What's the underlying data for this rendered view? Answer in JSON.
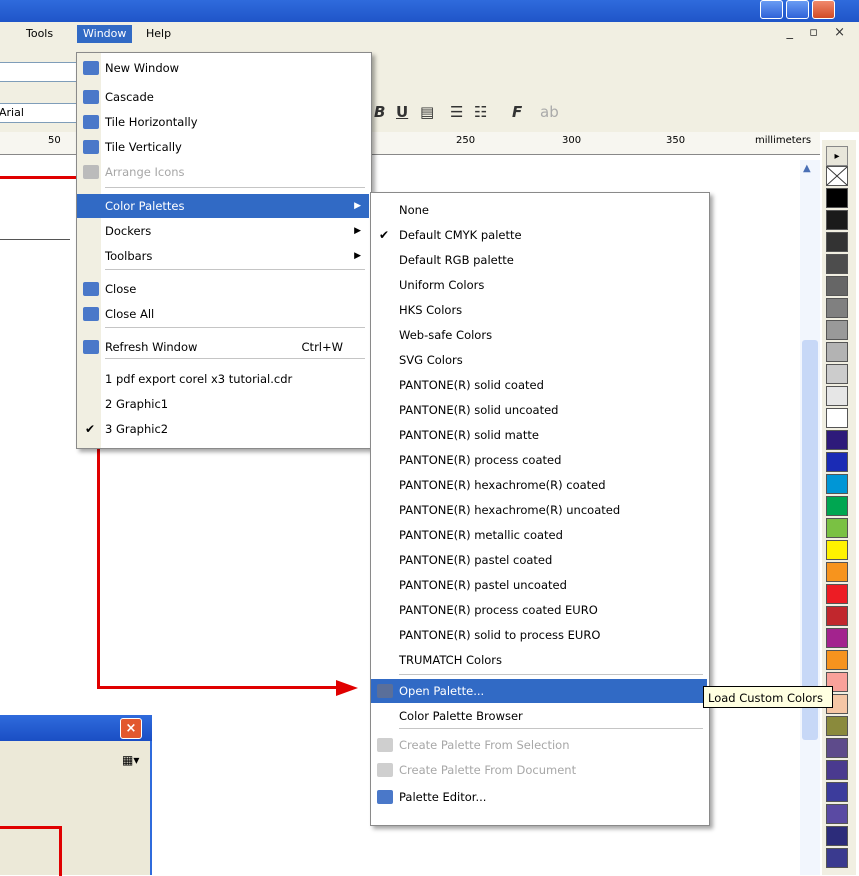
{
  "menubar": {
    "tools_label": "Tools",
    "window_label": "Window",
    "help_label": "Help",
    "mdi_buttons": "_ ▫ ×"
  },
  "toolbar": {
    "font_name": "Arial",
    "bold_label": "B",
    "underline_label": "U",
    "fmt_label": "F"
  },
  "ruler": {
    "ticks": [
      "50",
      "250",
      "300",
      "350"
    ],
    "unit": "millimeters"
  },
  "window_menu": {
    "items": [
      {
        "label": "New Window"
      },
      {
        "label": "Cascade"
      },
      {
        "label": "Tile Horizontally"
      },
      {
        "label": "Tile Vertically"
      },
      {
        "label": "Arrange Icons"
      },
      {
        "label": "Color Palettes"
      },
      {
        "label": "Dockers"
      },
      {
        "label": "Toolbars"
      },
      {
        "label": "Close"
      },
      {
        "label": "Close All"
      },
      {
        "label": "Refresh Window",
        "shortcut": "Ctrl+W"
      },
      {
        "label": "1 pdf export corel x3 tutorial.cdr"
      },
      {
        "label": "2 Graphic1"
      },
      {
        "label": "3 Graphic2"
      }
    ]
  },
  "palettes_menu": {
    "items": [
      {
        "label": "None"
      },
      {
        "label": "Default CMYK palette"
      },
      {
        "label": "Default RGB palette"
      },
      {
        "label": "Uniform Colors"
      },
      {
        "label": "HKS Colors"
      },
      {
        "label": "Web-safe Colors"
      },
      {
        "label": "SVG Colors"
      },
      {
        "label": "PANTONE(R) solid coated"
      },
      {
        "label": "PANTONE(R) solid uncoated"
      },
      {
        "label": "PANTONE(R) solid matte"
      },
      {
        "label": "PANTONE(R) process coated"
      },
      {
        "label": "PANTONE(R) hexachrome(R) coated"
      },
      {
        "label": "PANTONE(R) hexachrome(R) uncoated"
      },
      {
        "label": "PANTONE(R) metallic coated"
      },
      {
        "label": "PANTONE(R) pastel coated"
      },
      {
        "label": "PANTONE(R) pastel uncoated"
      },
      {
        "label": "PANTONE(R) process coated EURO"
      },
      {
        "label": "PANTONE(R) solid to process EURO"
      },
      {
        "label": "TRUMATCH Colors"
      },
      {
        "label": "Open Palette..."
      },
      {
        "label": "Color Palette Browser"
      },
      {
        "label": "Create Palette From Selection"
      },
      {
        "label": "Create Palette From Document"
      },
      {
        "label": "Palette Editor..."
      }
    ]
  },
  "tooltip": {
    "text": "Load Custom Colors"
  },
  "dialog": {
    "close_label": "×"
  },
  "icons": {
    "checkmark": "✔",
    "submenu_arrow": "▶",
    "scroll_up": "▲"
  },
  "colors": {
    "accent": "#316ac5",
    "annotation": "#e00000",
    "titlebar": "#2f6bdc"
  },
  "palette_swatches": [
    "#ffffff",
    "#000000",
    "#1a1a1a",
    "#333333",
    "#4d4d4d",
    "#666666",
    "#808080",
    "#999999",
    "#b3b3b3",
    "#cccccc",
    "#e6e6e6",
    "#ffffff",
    "#2e1a7a",
    "#1a2bb5",
    "#0096d6",
    "#00a651",
    "#7ac143",
    "#fff200",
    "#f7941d",
    "#ed1c24",
    "#c1272d",
    "#a3238e",
    "#f7931e",
    "#f9a19a",
    "#f5c6a5",
    "#8a8a3c",
    "#5e4b8b",
    "#4a3a8f",
    "#3c3c9c",
    "#5a4aa3",
    "#2c2c7a",
    "#3a3a8f",
    "#45458f"
  ]
}
